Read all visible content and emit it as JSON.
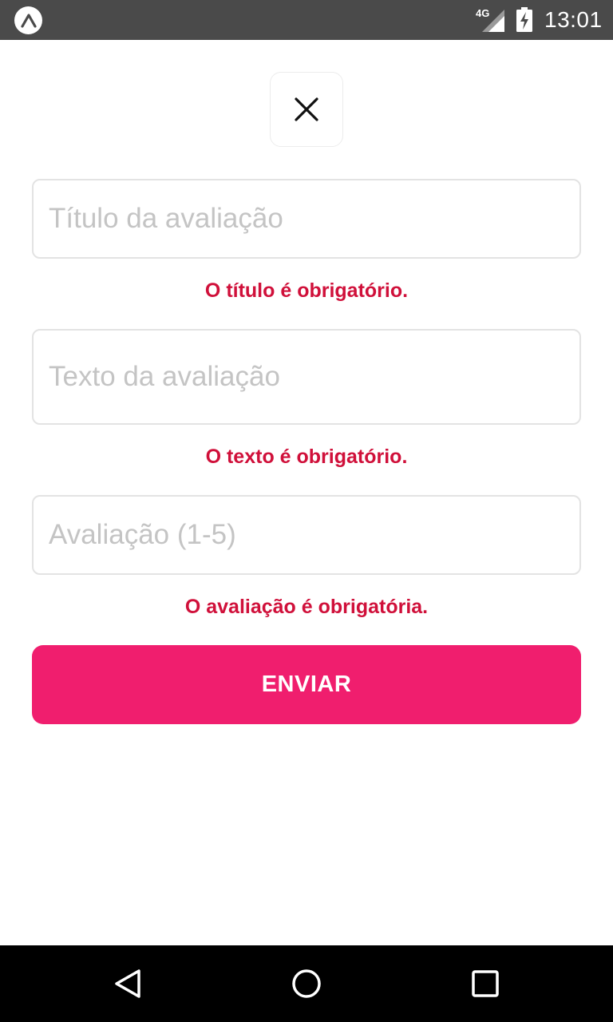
{
  "status_bar": {
    "network": "4G",
    "time": "13:01",
    "icons": [
      "expo-icon",
      "signal-icon",
      "battery-charging-icon"
    ]
  },
  "close_button": {
    "icon": "close-icon"
  },
  "form": {
    "title_field": {
      "placeholder": "Título da avaliação",
      "value": ""
    },
    "title_error": "O título é obrigatório.",
    "text_field": {
      "placeholder": "Texto da avaliação",
      "value": ""
    },
    "text_error": "O texto é obrigatório.",
    "rating_field": {
      "placeholder": "Avaliação (1-5)",
      "value": ""
    },
    "rating_error": "O avaliação é obrigatória.",
    "submit_label": "ENVIAR"
  },
  "nav_bar": {
    "icons": [
      "back-icon",
      "home-icon",
      "recents-icon"
    ]
  },
  "colors": {
    "accent": "#f01e6e",
    "error": "#d0103a",
    "status_bar": "#4a4a4a",
    "input_border": "#e3e3e3",
    "placeholder": "#c4c4c4"
  }
}
